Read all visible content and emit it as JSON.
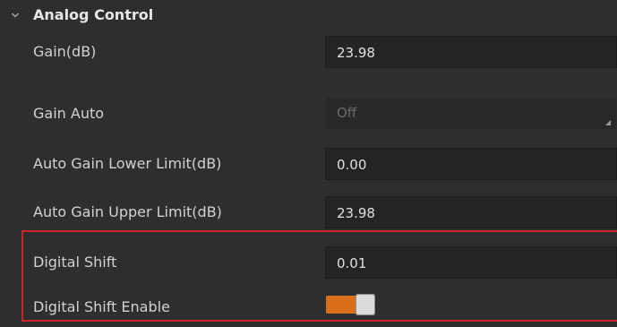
{
  "section": {
    "title": "Analog Control",
    "icon": "chevron-down-icon"
  },
  "rows": [
    {
      "label": "Gain(dB)",
      "value": "23.98",
      "type": "input"
    },
    {
      "label": "Gain Auto",
      "value": "Off",
      "type": "dropdown",
      "disabled": true
    },
    {
      "label": "Auto Gain Lower Limit(dB)",
      "value": "0.00",
      "type": "input"
    },
    {
      "label": "Auto Gain Upper Limit(dB)",
      "value": "23.98",
      "type": "input"
    },
    {
      "label": "Digital Shift",
      "value": "0.01",
      "type": "input"
    },
    {
      "label": "Digital Shift Enable",
      "type": "toggle",
      "checked": true
    }
  ],
  "colors": {
    "background": "#2d2e30",
    "field": "#232426",
    "toggle_on": "#d86d1a",
    "highlight_border": "#d3232a"
  }
}
